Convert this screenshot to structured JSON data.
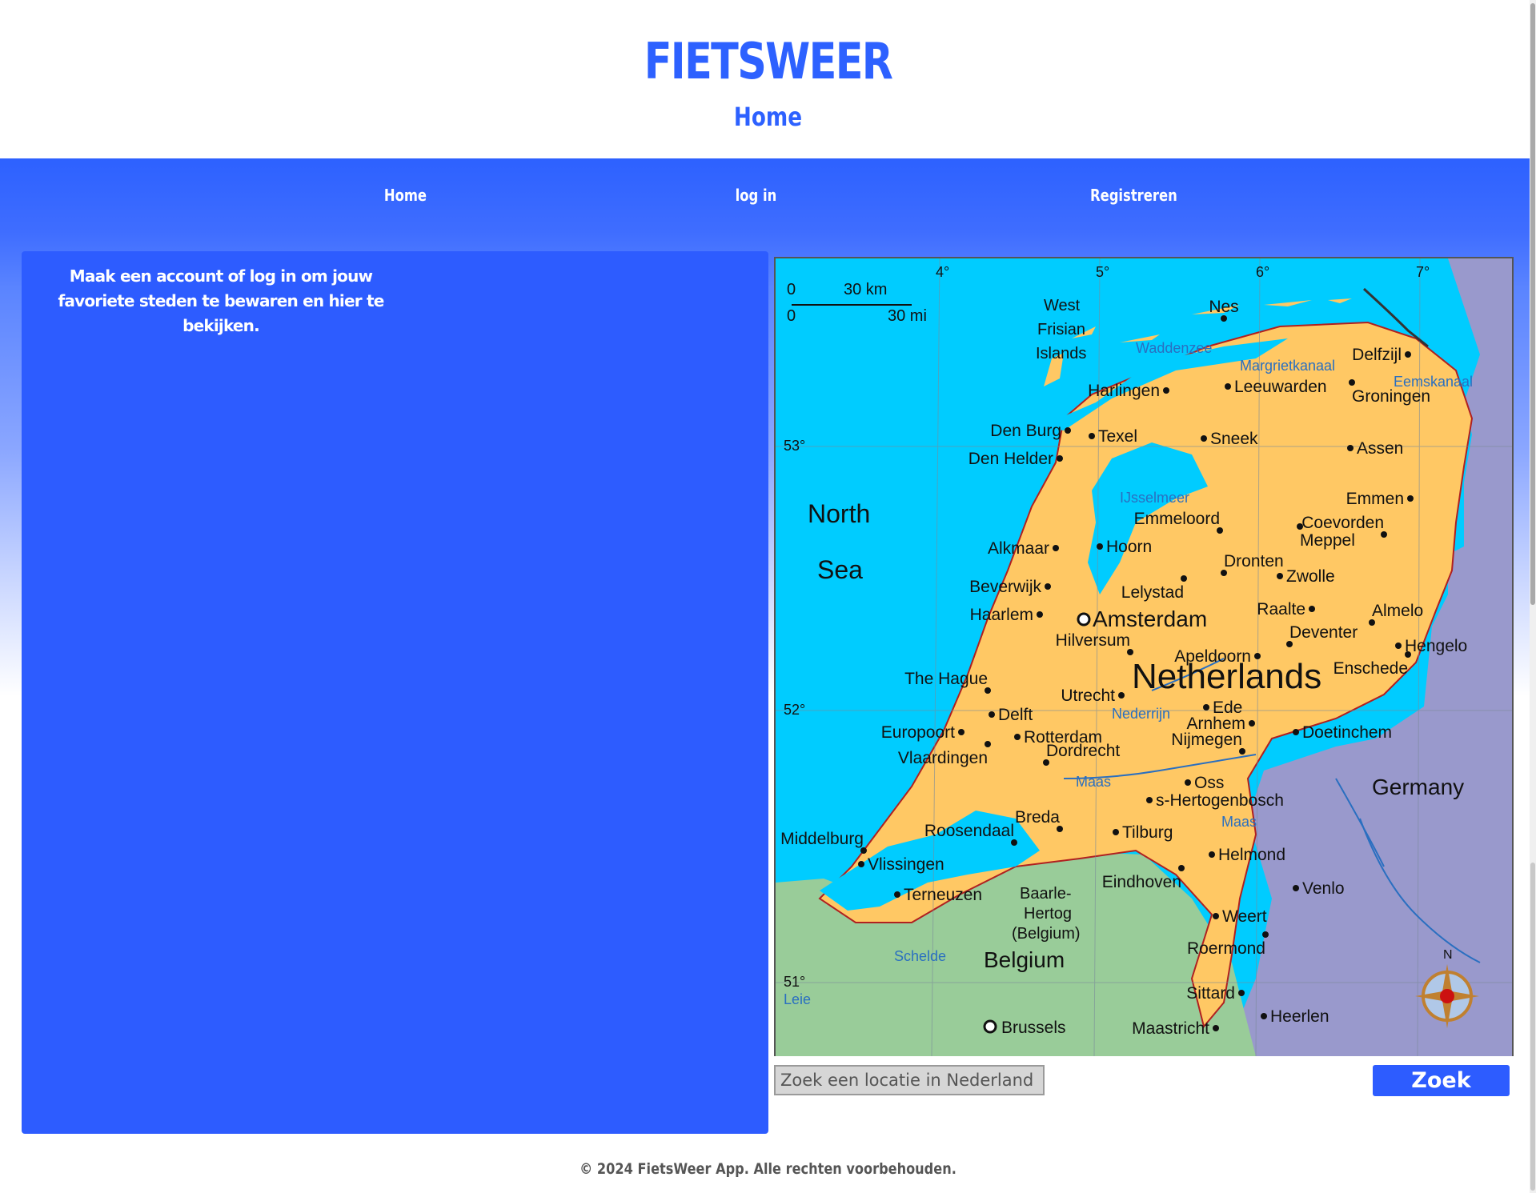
{
  "header": {
    "brand": "FIETSWEER",
    "page_title": "Home"
  },
  "nav": {
    "items": [
      {
        "label": "Home"
      },
      {
        "label": "log in"
      },
      {
        "label": "Registreren"
      }
    ]
  },
  "left_panel": {
    "message": "Maak een account of log in om jouw favoriete steden te bewaren en hier te bekijken."
  },
  "map": {
    "country_label": "Netherlands",
    "sea_labels": [
      "North",
      "Sea"
    ],
    "neighbor_labels": [
      "Germany",
      "Belgium"
    ],
    "islands_label": [
      "West",
      "Frisian",
      "Islands"
    ],
    "scale": {
      "km_zero": "0",
      "km_label": "30 km",
      "mi_zero": "0",
      "mi_label": "30 mi"
    },
    "longitudes": [
      "4°",
      "5°",
      "6°",
      "7°"
    ],
    "latitudes": [
      "53°",
      "52°",
      "51°"
    ],
    "water_labels": [
      "Waddenzee",
      "Margrietkanaal",
      "Eemskanaal",
      "IJsselmeer",
      "Nederrijn",
      "Maas",
      "Maas",
      "Schelde",
      "Leie"
    ],
    "baarle": [
      "Baarle-",
      "Hertog",
      "(Belgium)"
    ],
    "capital": "Amsterdam",
    "cities": [
      "Nes",
      "Delfzijl",
      "Harlingen",
      "Leeuwarden",
      "Groningen",
      "Den Burg",
      "Texel",
      "Sneek",
      "Assen",
      "Den Helder",
      "Emmen",
      "Emmeloord",
      "Coevorden",
      "Meppel",
      "Alkmaar",
      "Hoorn",
      "Dronten",
      "Zwolle",
      "Beverwijk",
      "Lelystad",
      "Raalte",
      "Almelo",
      "Haarlem",
      "Deventer",
      "Hengelo",
      "Hilversum",
      "Apeldoorn",
      "Enschede",
      "The Hague",
      "Utrecht",
      "Ede",
      "Delft",
      "Arnhem",
      "Europoort",
      "Rotterdam",
      "Doetinchem",
      "Vlaardingen",
      "Dordrecht",
      "Nijmegen",
      "Oss",
      "s-Hertogenbosch",
      "Breda",
      "Middelburg",
      "Roosendaal",
      "Tilburg",
      "Helmond",
      "Vlissingen",
      "Eindhoven",
      "Terneuzen",
      "Venlo",
      "Weert",
      "Roermond",
      "Sittard",
      "Heerlen",
      "Maastricht",
      "Brussels"
    ],
    "compass_label": "N"
  },
  "search": {
    "placeholder": "Zoek een locatie in Nederland",
    "value": "",
    "button_label": "Zoek"
  },
  "footer": {
    "text": "© 2024 FietsWeer App. Alle rechten voorbehouden."
  },
  "colors": {
    "brand": "#2d61ff",
    "panel": "#2d5cff",
    "map_land_nl": "#ffc864",
    "map_sea": "#00ccff",
    "map_germany": "#9999cc",
    "map_belgium": "#99cc99"
  }
}
